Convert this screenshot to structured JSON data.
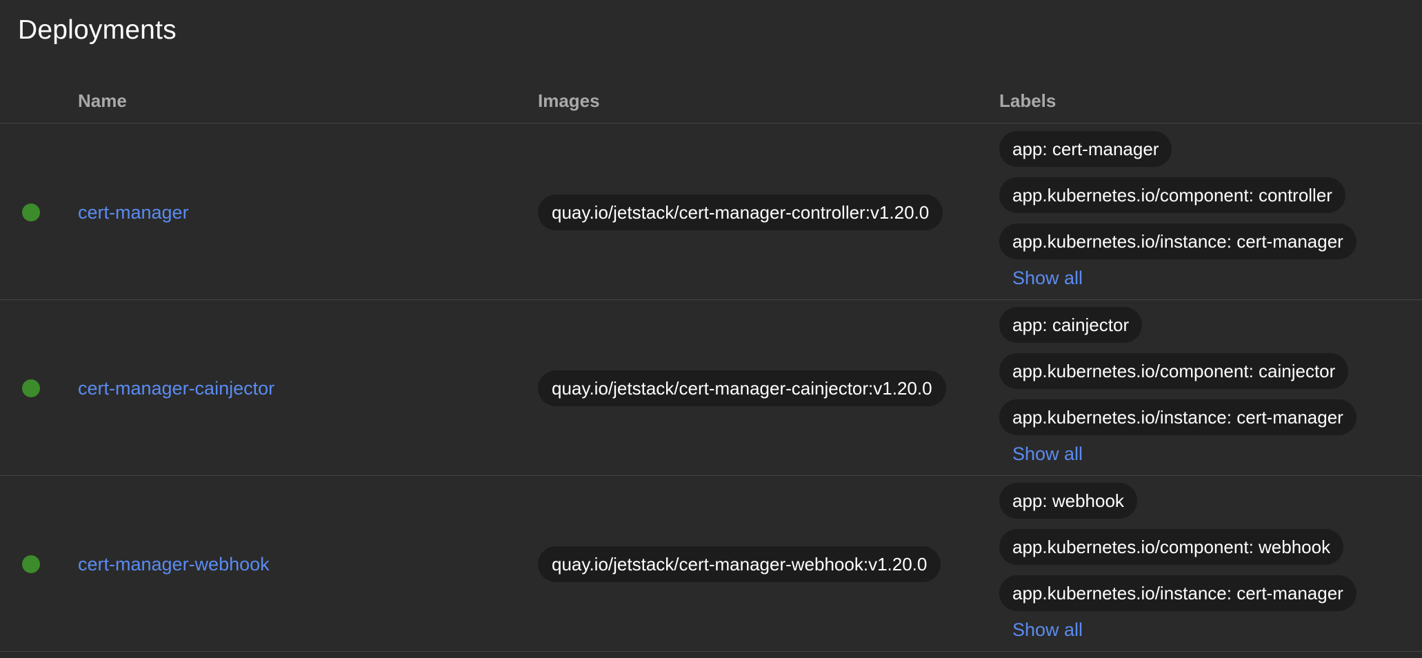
{
  "page": {
    "title": "Deployments"
  },
  "table": {
    "columns": {
      "name": "Name",
      "images": "Images",
      "labels": "Labels"
    },
    "show_all_label": "Show all",
    "rows": [
      {
        "status": "running",
        "name": "cert-manager",
        "image": "quay.io/jetstack/cert-manager-controller:v1.20.0",
        "labels": [
          "app: cert-manager",
          "app.kubernetes.io/component: controller",
          "app.kubernetes.io/instance: cert-manager"
        ]
      },
      {
        "status": "running",
        "name": "cert-manager-cainjector",
        "image": "quay.io/jetstack/cert-manager-cainjector:v1.20.0",
        "labels": [
          "app: cainjector",
          "app.kubernetes.io/component: cainjector",
          "app.kubernetes.io/instance: cert-manager"
        ]
      },
      {
        "status": "running",
        "name": "cert-manager-webhook",
        "image": "quay.io/jetstack/cert-manager-webhook:v1.20.0",
        "labels": [
          "app: webhook",
          "app.kubernetes.io/component: webhook",
          "app.kubernetes.io/instance: cert-manager"
        ]
      }
    ]
  },
  "colors": {
    "background": "#2a2a2a",
    "chip_background": "#1c1c1c",
    "link": "#5b8cf0",
    "status_ok": "#3d8b2a",
    "header_text": "#a9a9a9",
    "divider": "#454545"
  }
}
